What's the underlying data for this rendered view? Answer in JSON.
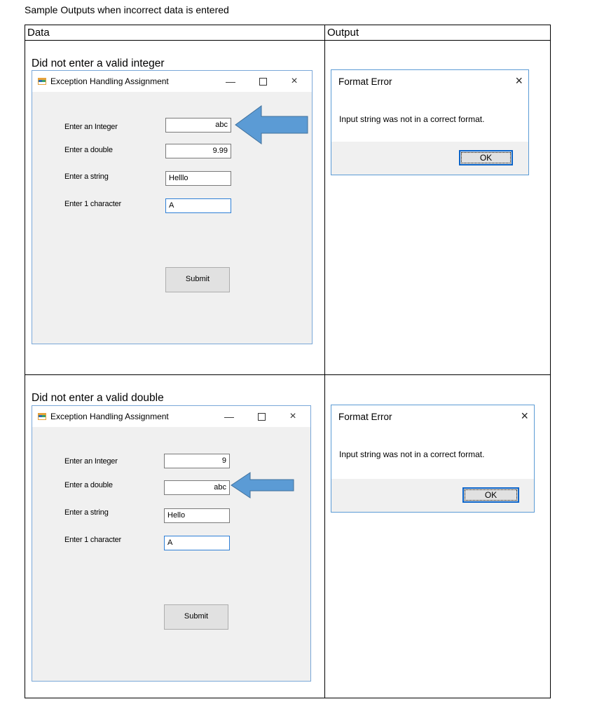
{
  "heading": "Sample Outputs when incorrect data is entered",
  "table": {
    "col_data": "Data",
    "col_output": "Output"
  },
  "rows": [
    {
      "caption": "Did not enter a valid integer",
      "form": {
        "title": "Exception Handling Assignment",
        "labels": [
          "Enter an Integer",
          "Enter a double",
          "Enter a string",
          "Enter 1 character"
        ],
        "values": [
          "abc",
          "9.99",
          "Helllo",
          "A"
        ],
        "submit": "Submit"
      },
      "dialog": {
        "title": "Format Error",
        "message": "Input string was not in a correct format.",
        "ok": "OK"
      }
    },
    {
      "caption": "Did not enter a valid double",
      "form": {
        "title": "Exception Handling Assignment",
        "labels": [
          "Enter an Integer",
          "Enter a double",
          "Enter a string",
          "Enter 1 character"
        ],
        "values": [
          "9",
          "abc",
          "Hello",
          "A"
        ],
        "submit": "Submit"
      },
      "dialog": {
        "title": "Format Error",
        "message": "Input string was not in a correct format.",
        "ok": "OK"
      }
    }
  ],
  "icons": {
    "close": "×",
    "minimize": "—"
  },
  "colors": {
    "arrow": "#5b9bd5",
    "window_border": "#7aa7d8",
    "focus": "#2e7fd6"
  }
}
